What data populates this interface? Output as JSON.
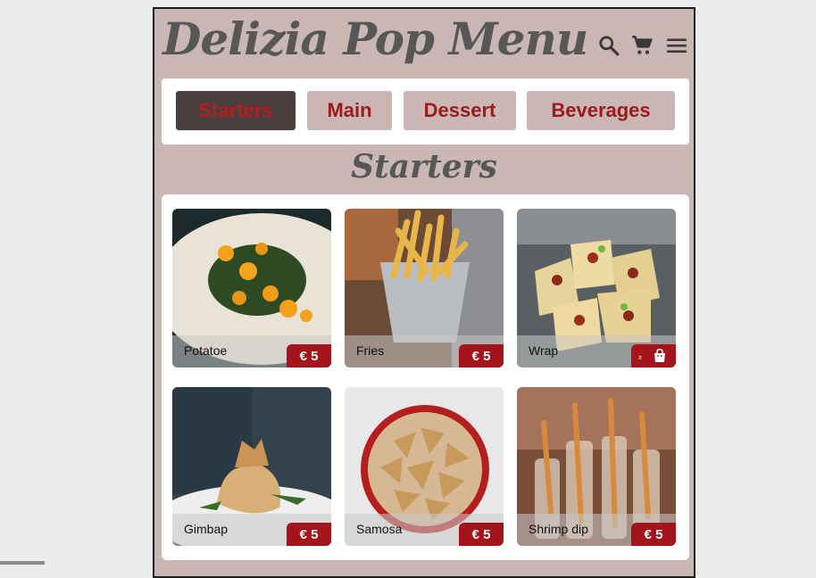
{
  "header": {
    "logo": "Delizia Pop Menu",
    "icons": [
      "search-icon",
      "cart-icon",
      "menu-icon"
    ]
  },
  "tabs": [
    {
      "label": "Starters",
      "active": true
    },
    {
      "label": "Main",
      "active": false
    },
    {
      "label": "Dessert",
      "active": false
    },
    {
      "label": "Beverages",
      "active": false
    }
  ],
  "section_title": "Starters",
  "items": [
    {
      "name": "Potatoe",
      "price": "€ 5"
    },
    {
      "name": "Fries",
      "price": "€ 5"
    },
    {
      "name": "Wrap",
      "price": "₂",
      "hover_icon": "shopping-bag-icon"
    },
    {
      "name": "Gimbap",
      "price": "€ 5"
    },
    {
      "name": "Samosa",
      "price": "€ 5"
    },
    {
      "name": "Shrimp dip",
      "price": "€ 5"
    }
  ],
  "colors": {
    "page_bg": "#ececec",
    "app_bg": "#c9b6b5",
    "accent": "#a3141b",
    "tab_text": "#9b1b1b",
    "active_tab_bg": "#4a3e3e",
    "title_text": "#575757"
  }
}
